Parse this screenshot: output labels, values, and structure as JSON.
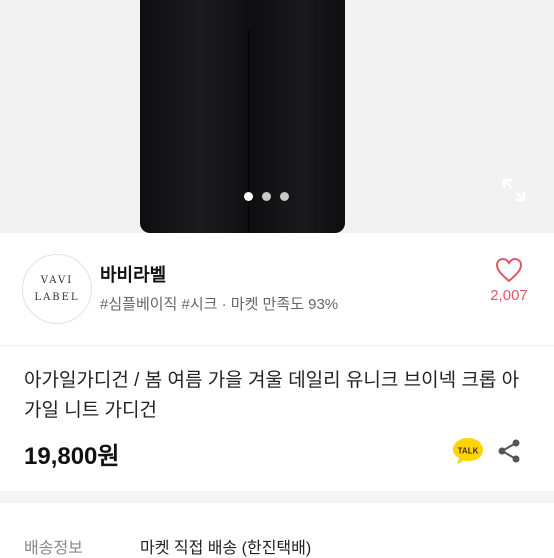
{
  "hero": {
    "dots": [
      true,
      false,
      false
    ]
  },
  "seller": {
    "logo_line1": "VAVI",
    "logo_line2": "LABEL",
    "name": "바비라벨",
    "tags": "#심플베이직 #시크 · 마켓 만족도 93%",
    "likes": "2,007"
  },
  "product": {
    "title": "아가일가디건 / 봄 여름 가을 겨울 데일리 유니크 브이넥 크롭 아가일 니트 가디건",
    "price": "19,800원"
  },
  "shipping": {
    "label": "배송정보",
    "value": "마켓 직접 배송 (한진택배)"
  },
  "colors": {
    "accent": "#e05a66",
    "talk": "#3b2e1e"
  }
}
